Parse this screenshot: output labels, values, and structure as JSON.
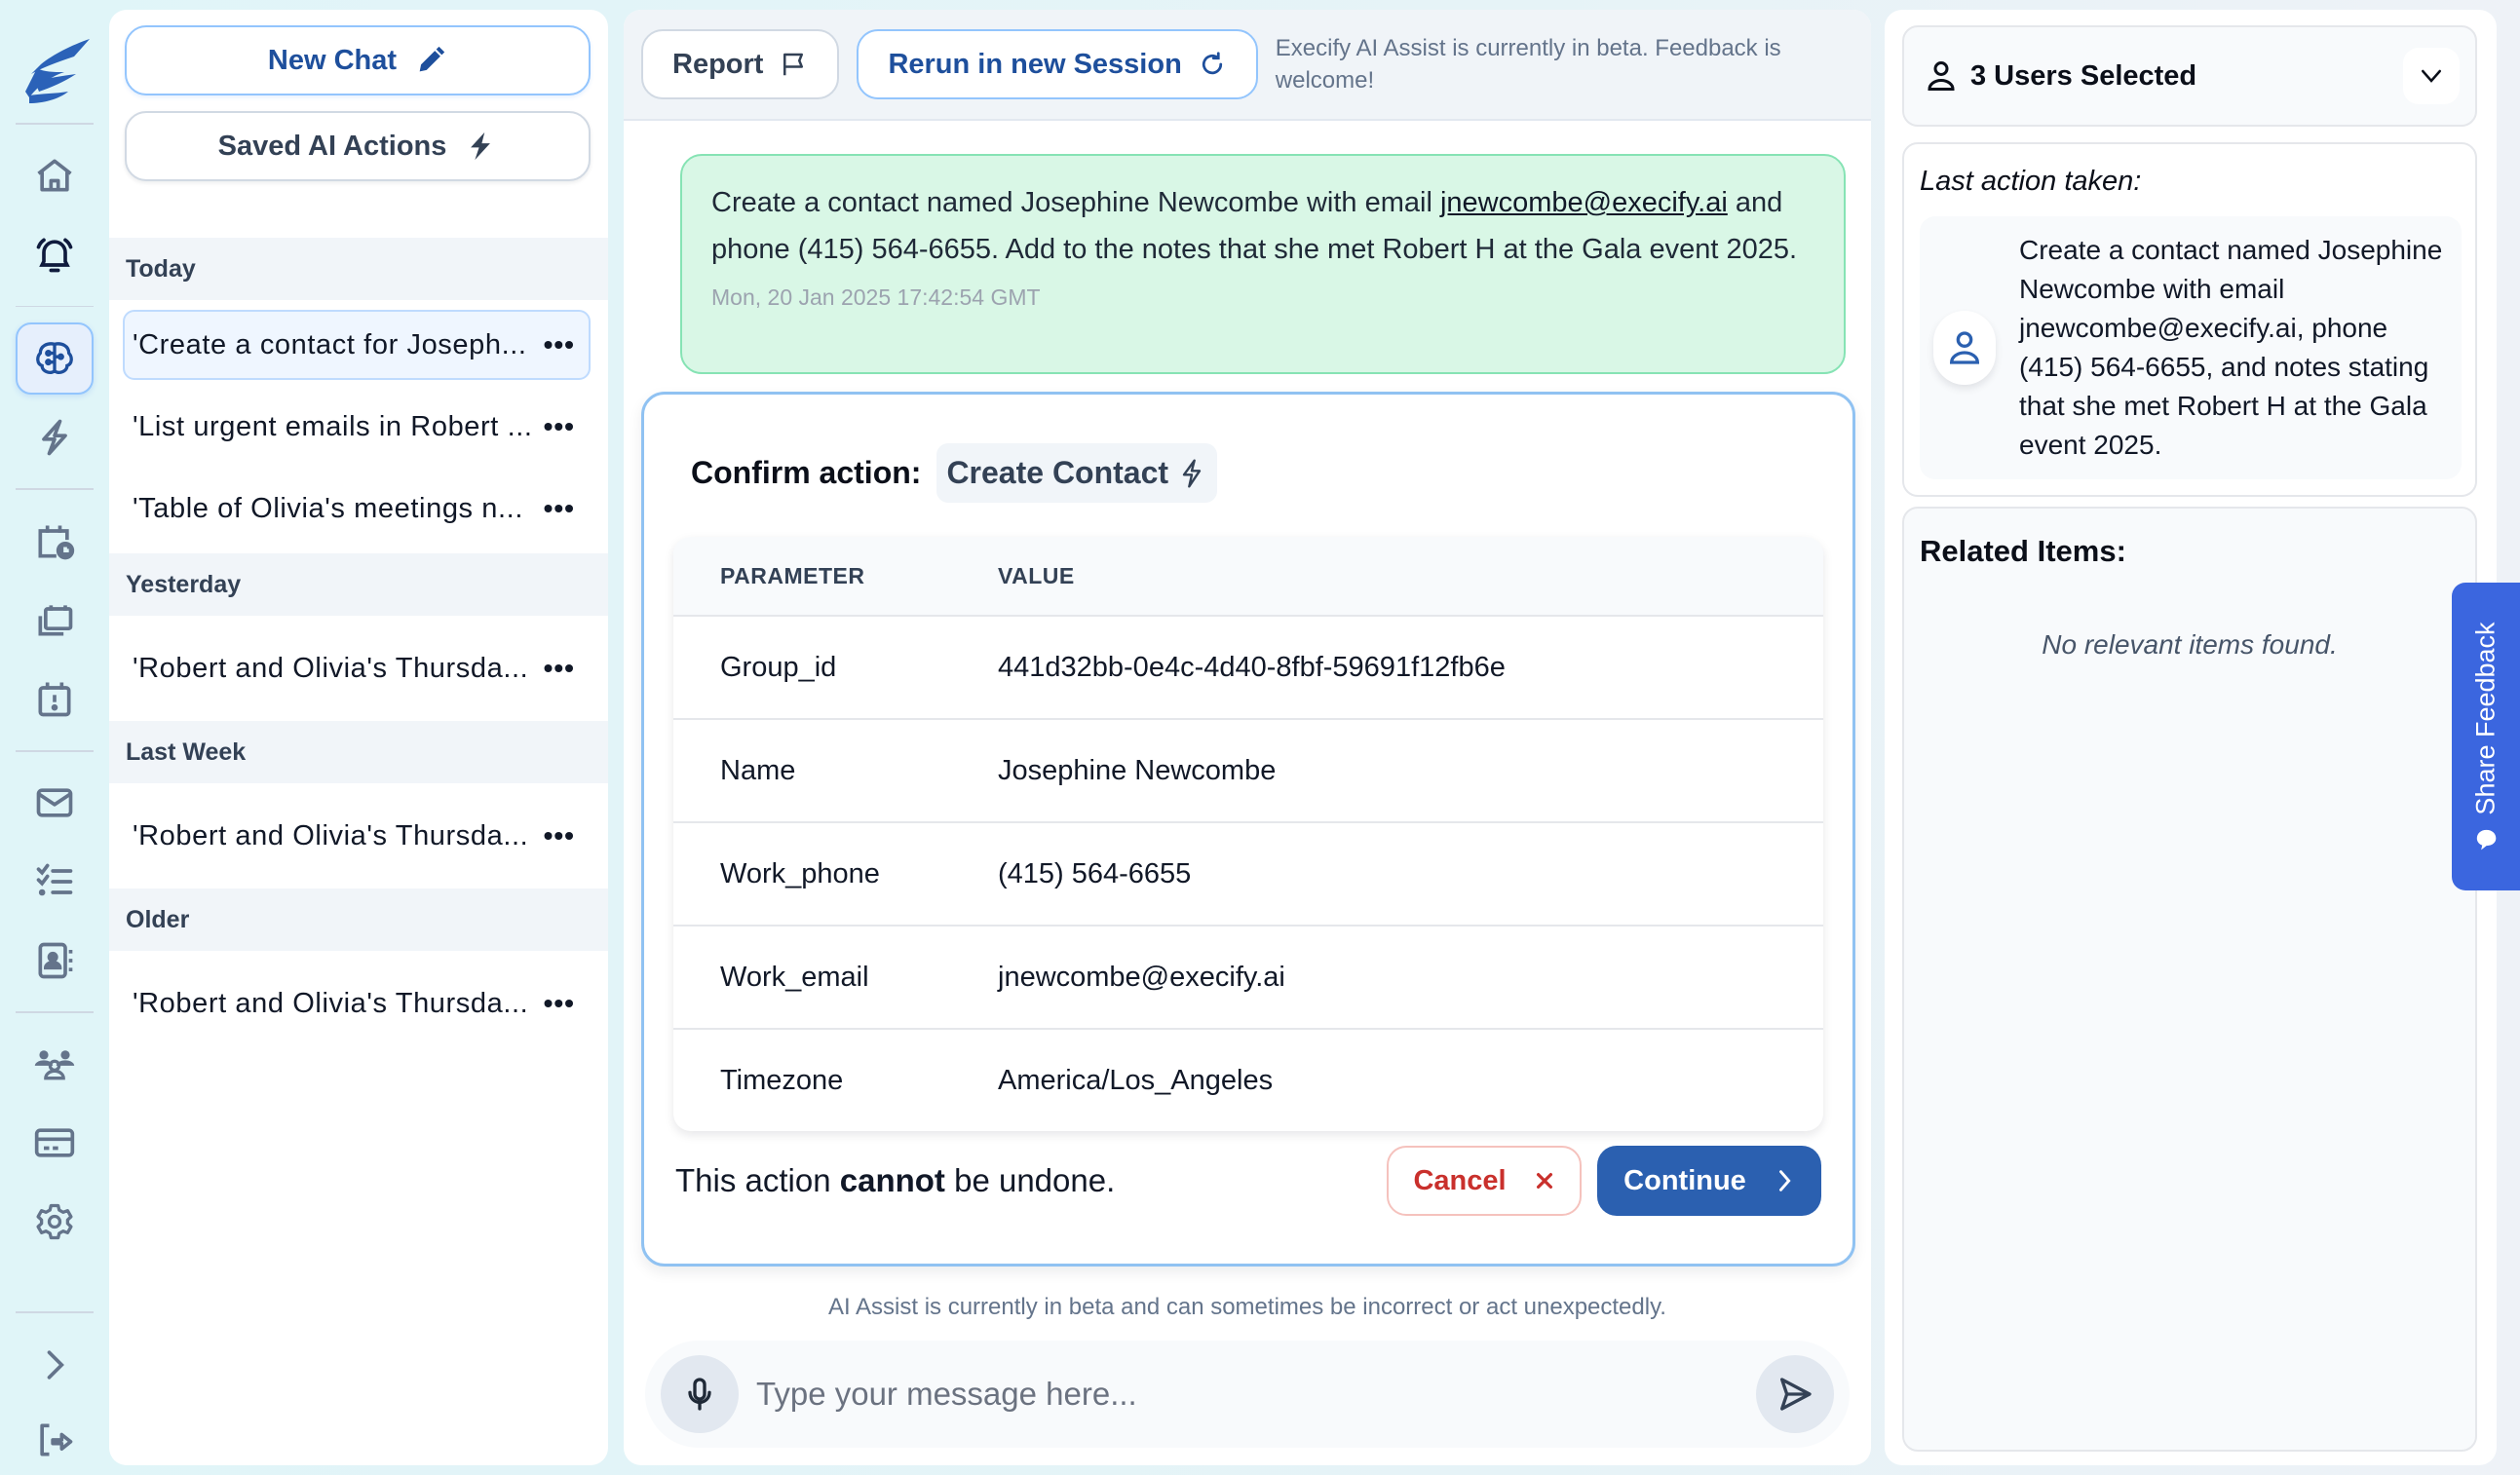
{
  "app": {
    "brand": "Execify",
    "colors": {
      "accent": "#2b60b0",
      "cancel": "#c9302c",
      "user_bubble": "#d9f7e6",
      "feedback_tab": "#3b66df"
    }
  },
  "rail": {
    "items": [
      {
        "name": "home",
        "icon": "home-icon"
      },
      {
        "name": "alerts",
        "icon": "bell-icon"
      },
      {
        "name": "ai-assist",
        "icon": "brain-icon",
        "active": true
      },
      {
        "name": "actions",
        "icon": "lightning-icon"
      },
      {
        "name": "scheduled-meetings",
        "icon": "calendar-clock-icon"
      },
      {
        "name": "calendars",
        "icon": "calendar-stack-icon"
      },
      {
        "name": "urgent-events",
        "icon": "calendar-alert-icon"
      },
      {
        "name": "email",
        "icon": "mail-icon"
      },
      {
        "name": "tasks",
        "icon": "checklist-icon"
      },
      {
        "name": "contacts",
        "icon": "contact-book-icon"
      },
      {
        "name": "team",
        "icon": "users-icon"
      },
      {
        "name": "billing",
        "icon": "credit-card-icon"
      },
      {
        "name": "settings",
        "icon": "gear-icon"
      },
      {
        "name": "expand",
        "icon": "chevron-right-icon"
      },
      {
        "name": "logout",
        "icon": "logout-icon"
      }
    ]
  },
  "history": {
    "new_chat": "New Chat",
    "saved_actions": "Saved AI Actions",
    "groups": [
      {
        "label": "Today",
        "items": [
          {
            "title": "'Create a contact for Joseph...",
            "selected": true
          },
          {
            "title": "'List urgent emails in Robert ..."
          },
          {
            "title": "'Table of Olivia's meetings n..."
          }
        ]
      },
      {
        "label": "Yesterday",
        "items": [
          {
            "title": "'Robert and Olivia's Thursda..."
          }
        ]
      },
      {
        "label": "Last Week",
        "items": [
          {
            "title": "'Robert and Olivia's Thursda..."
          }
        ]
      },
      {
        "label": "Older",
        "items": [
          {
            "title": "'Robert and Olivia's Thursda..."
          }
        ]
      }
    ],
    "more_label": "•••"
  },
  "chat": {
    "toolbar": {
      "report": "Report",
      "rerun": "Rerun in new Session",
      "beta_note": "Execify AI Assist is currently in beta. Feedback is welcome!"
    },
    "user_message": {
      "before_link": "Create a contact named Josephine Newcombe with email ",
      "link": "jnewcombe@execify.ai",
      "after_link": " and phone (415) 564-6655. Add to the notes that she met Robert H at the Gala event 2025.",
      "timestamp": "Mon, 20 Jan 2025 17:42:54 GMT"
    },
    "confirm": {
      "label": "Confirm action:",
      "action": "Create Contact",
      "headers": {
        "parameter": "PARAMETER",
        "value": "VALUE"
      },
      "rows": [
        {
          "parameter": "Group_id",
          "value": "441d32bb-0e4c-4d40-8fbf-59691f12fb6e"
        },
        {
          "parameter": "Name",
          "value": "Josephine Newcombe"
        },
        {
          "parameter": "Work_phone",
          "value": "(415) 564-6655"
        },
        {
          "parameter": "Work_email",
          "value": "jnewcombe@execify.ai"
        },
        {
          "parameter": "Timezone",
          "value": "America/Los_Angeles"
        }
      ],
      "warning_pre": "This action ",
      "warning_bold": "cannot",
      "warning_post": " be undone.",
      "cancel": "Cancel",
      "continue": "Continue"
    },
    "disclaimer": "AI Assist is currently in beta and can sometimes be incorrect or act unexpectedly.",
    "composer": {
      "placeholder": "Type your message here...",
      "value": ""
    }
  },
  "right": {
    "users_selected": "3 Users Selected",
    "last_action_label": "Last action taken:",
    "last_action_text": "Create a contact named Josephine Newcombe with email jnewcombe@execify.ai, phone (415) 564-6655, and notes stating that she met Robert H at the Gala event 2025.",
    "related_label": "Related Items:",
    "related_empty": "No relevant items found."
  },
  "feedback": {
    "label": "Share Feedback"
  }
}
